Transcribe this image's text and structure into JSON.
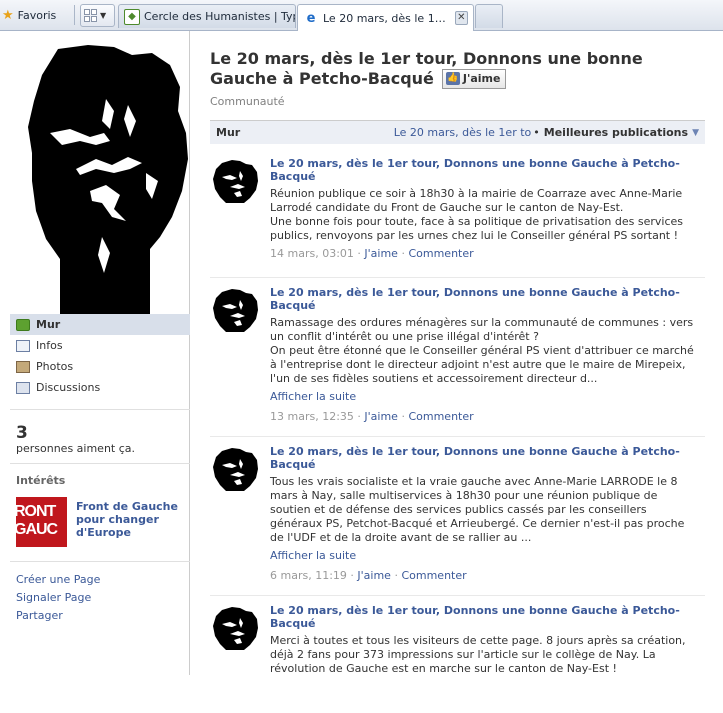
{
  "browser": {
    "favorites_label": "Favoris",
    "tabs": [
      {
        "title": "Cercle des Humanistes | Typ..."
      },
      {
        "title": "Le 20 mars, dès le 1er to...",
        "active": true
      }
    ]
  },
  "sidebar": {
    "nav": [
      {
        "label": "Mur",
        "icon": "wall-icon",
        "active": true
      },
      {
        "label": "Infos",
        "icon": "info-icon"
      },
      {
        "label": "Photos",
        "icon": "photos-icon"
      },
      {
        "label": "Discussions",
        "icon": "discussions-icon"
      }
    ],
    "likes_count": "3",
    "likes_text": "personnes aiment ça.",
    "interests_heading": "Intérêts",
    "interest": {
      "name": "Front de Gauche pour changer d'Europe",
      "logo_text_1": "RONT",
      "logo_text_2": "GAUC"
    },
    "links": [
      "Créer une Page",
      "Signaler Page",
      "Partager"
    ]
  },
  "page": {
    "title": "Le 20 mars, dès le 1er tour, Donnons une bonne Gauche à Petcho-Bacqué",
    "like_button": "J'aime",
    "category": "Communauté",
    "wall_label": "Mur",
    "filter_name": "Le 20 mars, dès le 1er to",
    "filter_dots": "•",
    "sort_label": "Meilleures publications"
  },
  "posts": [
    {
      "title": "Le 20 mars, dès le 1er tour, Donnons une bonne Gauche à Petcho-Bacqué",
      "body": [
        "Réunion publique ce soir à 18h30 à la mairie de Coarraze avec Anne-Marie Larrodé candidate du Front de Gauche sur le canton de Nay-Est.",
        "Une bonne fois pour toute, face à sa politique de privatisation des services publics, renvoyons par les urnes chez lui le Conseiller général PS sortant !"
      ],
      "more": "",
      "time": "14 mars, 03:01",
      "like": "J'aime",
      "comment": "Commenter"
    },
    {
      "title": "Le 20 mars, dès le 1er tour, Donnons une bonne Gauche à Petcho-Bacqué",
      "body": [
        "Ramassage des ordures ménagères sur la communauté de communes : vers un conflit d'intérêt ou une prise illégal d'intérêt ?",
        "On peut être étonné que le Conseiller général PS vient d'attribuer ce marché à l'entreprise dont le directeur adjoint n'est autre que le maire de Mirepeix, l'un de ses fidèles soutiens et accessoirement directeur d..."
      ],
      "more": "Afficher la suite",
      "time": "13 mars, 12:35",
      "like": "J'aime",
      "comment": "Commenter"
    },
    {
      "title": "Le 20 mars, dès le 1er tour, Donnons une bonne Gauche à Petcho-Bacqué",
      "body": [
        "Tous les vrais socialiste et la vraie gauche avec Anne-Marie LARRODE le 8 mars à Nay, salle multiservices à 18h30 pour une réunion publique de soutien et de défense des services publics cassés par les conseillers généraux PS, Petchot-Bacqué et Arrieubergé. Ce dernier n'est-il pas proche de l'UDF et de la droite avant de se rallier au ..."
      ],
      "more": "Afficher la suite",
      "time": "6 mars, 11:19",
      "like": "J'aime",
      "comment": "Commenter"
    },
    {
      "title": "Le 20 mars, dès le 1er tour, Donnons une bonne Gauche à Petcho-Bacqué",
      "body": [
        "Merci à toutes et tous les visiteurs de cette page. 8 jours après sa création, déjà 2 fans pour 373 impressions sur l'article sur le collège de Nay. La révolution de Gauche est en marche sur le canton de Nay-Est !"
      ],
      "more": "",
      "time": "",
      "like": "",
      "comment": ""
    }
  ]
}
